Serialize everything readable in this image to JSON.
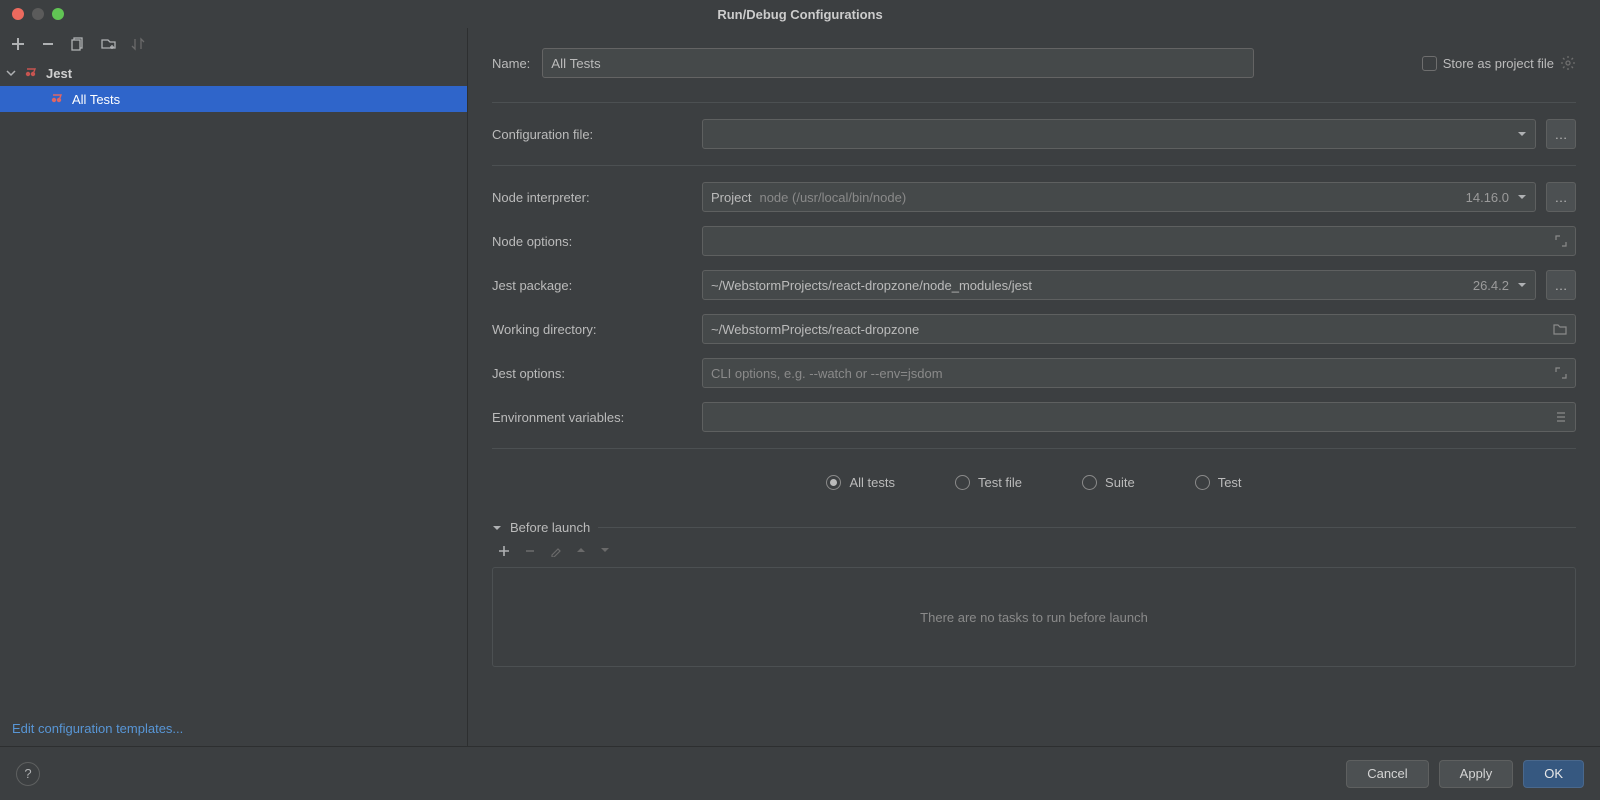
{
  "window": {
    "title": "Run/Debug Configurations"
  },
  "sidebar": {
    "group": "Jest",
    "selected_item": "All Tests",
    "edit_templates_link": "Edit configuration templates..."
  },
  "form": {
    "name_label": "Name:",
    "name_value": "All Tests",
    "store_label": "Store as project file",
    "config_file_label": "Configuration file:",
    "config_file_value": "",
    "node_interpreter_label": "Node interpreter:",
    "node_interpreter_prefix": "Project",
    "node_interpreter_value": "node (/usr/local/bin/node)",
    "node_interpreter_version": "14.16.0",
    "node_options_label": "Node options:",
    "node_options_value": "",
    "jest_package_label": "Jest package:",
    "jest_package_value": "~/WebstormProjects/react-dropzone/node_modules/jest",
    "jest_package_version": "26.4.2",
    "working_dir_label": "Working directory:",
    "working_dir_value": "~/WebstormProjects/react-dropzone",
    "jest_options_label": "Jest options:",
    "jest_options_placeholder": "CLI options, e.g. --watch or --env=jsdom",
    "env_vars_label": "Environment variables:",
    "env_vars_value": "",
    "scope": {
      "all_tests": "All tests",
      "test_file": "Test file",
      "suite": "Suite",
      "test": "Test",
      "selected": "all_tests"
    }
  },
  "before_launch": {
    "title": "Before launch",
    "empty_text": "There are no tasks to run before launch"
  },
  "footer": {
    "cancel": "Cancel",
    "apply": "Apply",
    "ok": "OK"
  }
}
